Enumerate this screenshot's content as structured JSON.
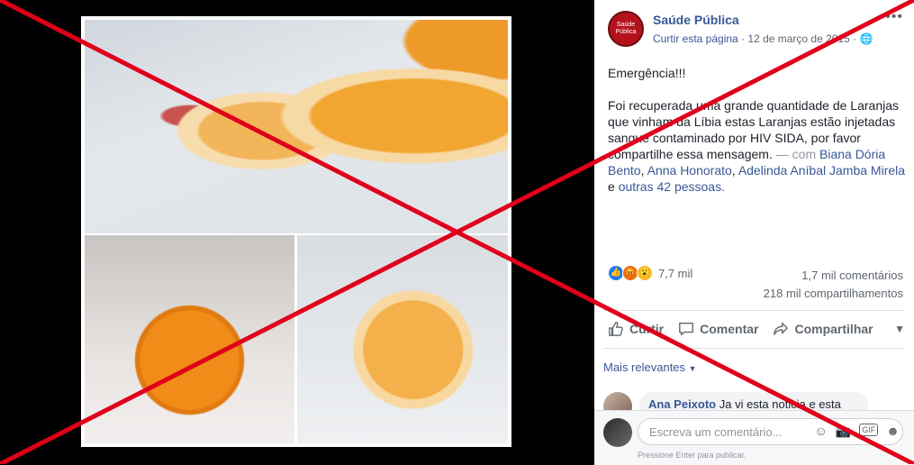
{
  "post": {
    "page_name": "Saúde Pública",
    "avatar_text": "Saúde Pública",
    "like_page": "Curtir esta página",
    "date": "· 12 de março de 2015 ·",
    "more": "•••",
    "text_line1": "Emergência!!!",
    "text_body": "Foi recuperada uma grande quantidade de Laranjas que vinham da Líbia estas Laranjas estão injetadas sangue contaminado por HIV SIDA, por favor compartilhe essa mensagem.",
    "with_label": "— com",
    "tagged1": "Biana Dória Bento",
    "tagged2": "Anna Honorato",
    "tagged3": "Adelinda Aníbal Jamba Mirela",
    "and_label": "e",
    "others": "outras 42 pessoas",
    "period": "."
  },
  "stats": {
    "reactions_count": "7,7 mil",
    "comments": "1,7 mil comentários",
    "shares": "218 mil compartilhamentos"
  },
  "actions": {
    "like": "Curtir",
    "comment": "Comentar",
    "share": "Compartilhar"
  },
  "comments": {
    "filter": "Mais relevantes",
    "first_author": "Ana Peixoto",
    "first_text": "Ja vi esta noticia e esta foto",
    "input_placeholder": "Escreva um comentário...",
    "hint": "Pressione Enter para publicar."
  },
  "icons": [
    "smile-icon",
    "camera-icon",
    "gif-icon",
    "sticker-icon",
    "like-icon",
    "comment-icon",
    "share-icon",
    "globe-icon"
  ],
  "colors": {
    "accent_link": "#385898",
    "cross_red": "#e0001b",
    "brand_red": "#b3121d"
  }
}
